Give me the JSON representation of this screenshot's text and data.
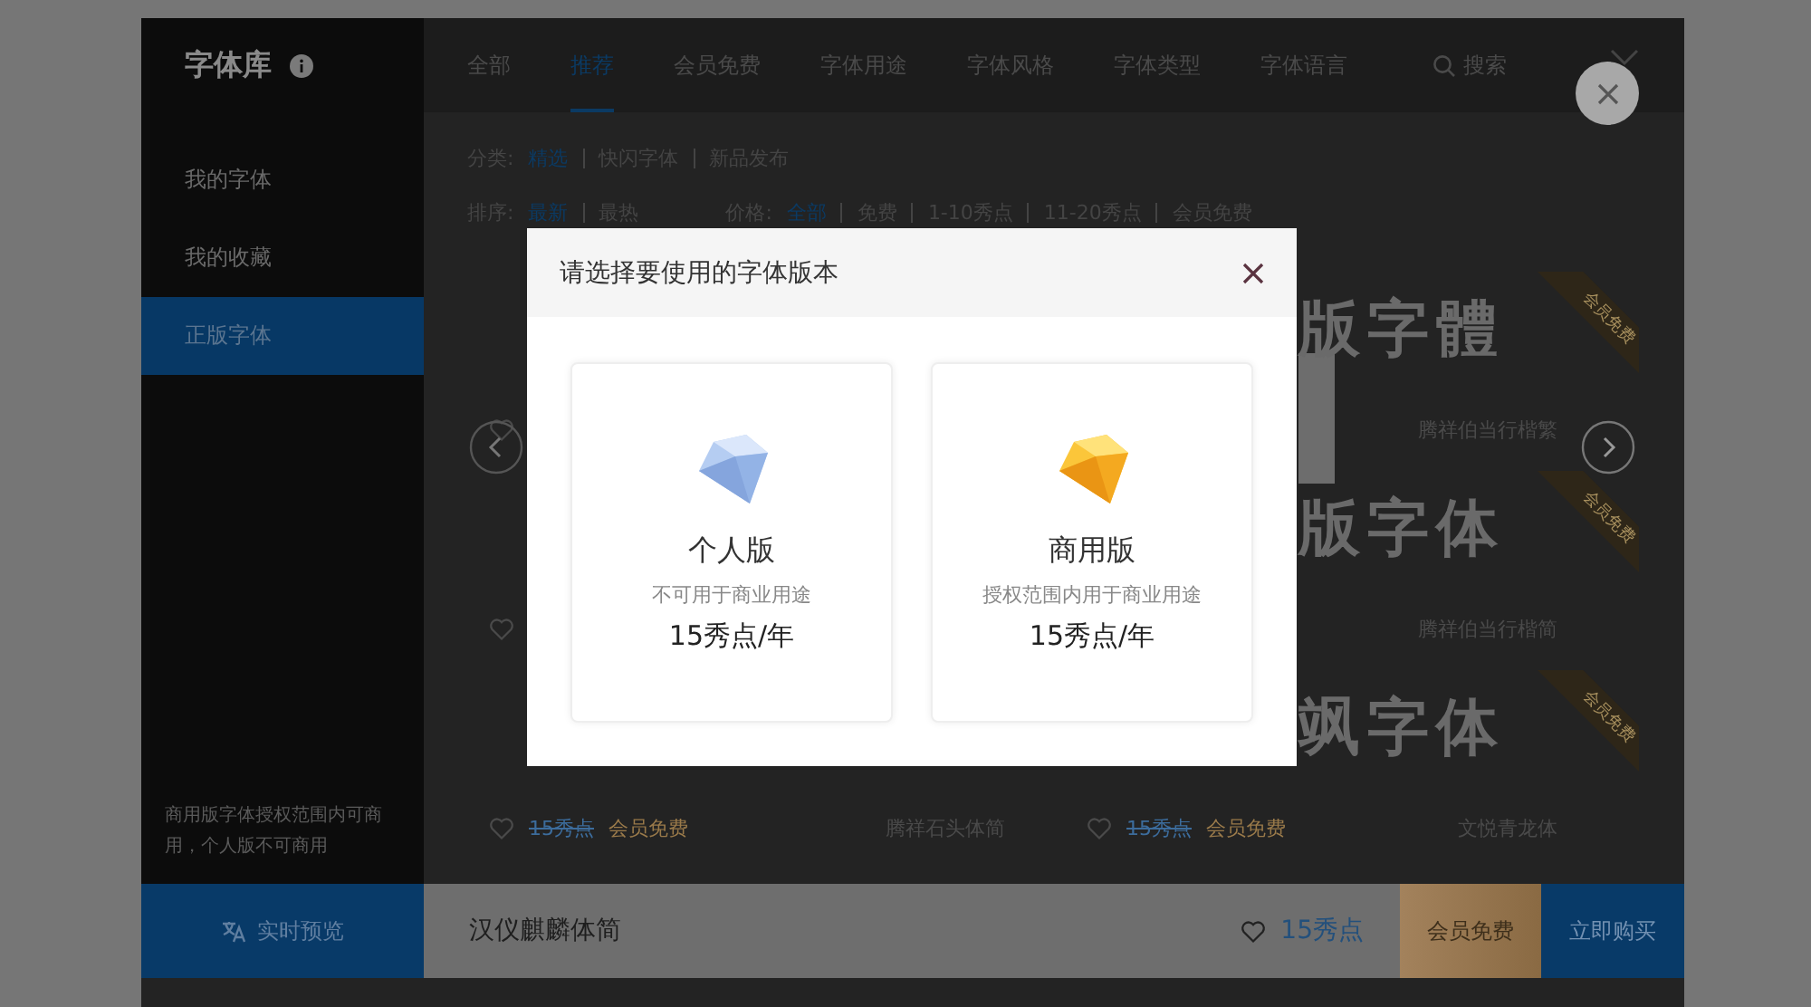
{
  "sidebar": {
    "title": "字体库",
    "items": [
      {
        "label": "我的字体",
        "selected": false
      },
      {
        "label": "我的收藏",
        "selected": false
      },
      {
        "label": "正版字体",
        "selected": true
      }
    ],
    "note": "商用版字体授权范围内可商用，个人版不可商用"
  },
  "tabs": [
    {
      "label": "全部",
      "selected": false
    },
    {
      "label": "推荐",
      "selected": true
    },
    {
      "label": "会员免费",
      "selected": false
    },
    {
      "label": "字体用途",
      "selected": false
    },
    {
      "label": "字体风格",
      "selected": false
    },
    {
      "label": "字体类型",
      "selected": false
    },
    {
      "label": "字体语言",
      "selected": false
    }
  ],
  "search": {
    "label": "搜索"
  },
  "filters": [
    {
      "label": "分类:",
      "options": [
        {
          "label": "精选",
          "selected": true
        },
        {
          "label": "快闪字体",
          "selected": false
        },
        {
          "label": "新品发布",
          "selected": false
        }
      ]
    },
    {
      "label": "排序:",
      "options": [
        {
          "label": "最新",
          "selected": true
        },
        {
          "label": "最热",
          "selected": false
        }
      ]
    },
    {
      "label": "价格:",
      "options": [
        {
          "label": "全部",
          "selected": true
        },
        {
          "label": "免费",
          "selected": false
        },
        {
          "label": "1-10秀点",
          "selected": false
        },
        {
          "label": "11-20秀点",
          "selected": false
        },
        {
          "label": "会员免费",
          "selected": false
        }
      ]
    }
  ],
  "font_rows": [
    [
      {
        "favorite": false
      },
      {
        "sample": "版字體",
        "badge": "会员免费",
        "name": "腾祥伯当行楷繁"
      }
    ],
    [
      {
        "favorite": false
      },
      {
        "sample": "版字体",
        "badge": "会员免费",
        "name": "腾祥伯当行楷简"
      }
    ],
    [
      {
        "favorite": false,
        "price": "15秀点",
        "member": "会员免费",
        "name": "腾祥石头体简"
      },
      {
        "sample": "飒字体",
        "badge": "会员免费",
        "favorite": false,
        "price": "15秀点",
        "member": "会员免费",
        "name": "文悦青龙体"
      }
    ]
  ],
  "bottom_bar": {
    "preview_button": "实时预览",
    "font_name": "汉仪麒麟体简",
    "favorite": false,
    "price": "15秀点",
    "member_button": "会员免费",
    "buy_button": "立即购买"
  },
  "dialog": {
    "title": "请选择要使用的字体版本",
    "options": [
      {
        "kind": "personal",
        "title": "个人版",
        "description": "不可用于商业用途",
        "price": "15秀点/年"
      },
      {
        "kind": "commercial",
        "title": "商用版",
        "description": "授权范围内用于商业用途",
        "price": "15秀点/年"
      }
    ]
  }
}
